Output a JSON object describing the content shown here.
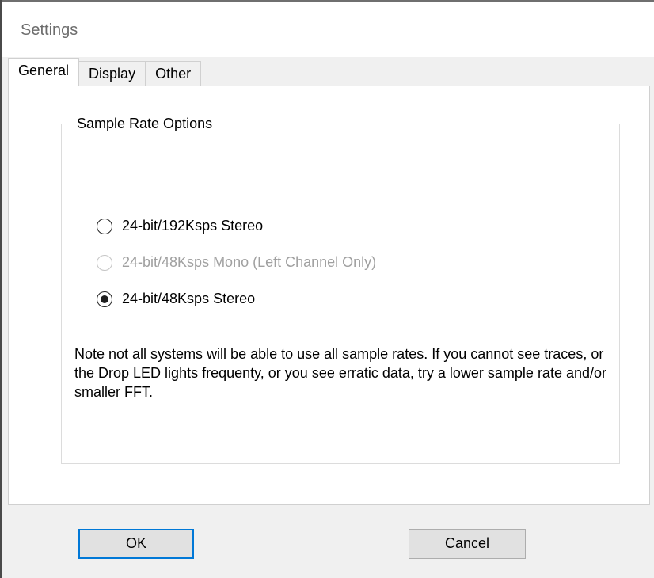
{
  "window": {
    "title": "Settings"
  },
  "tabs": [
    {
      "label": "General",
      "active": true
    },
    {
      "label": "Display",
      "active": false
    },
    {
      "label": "Other",
      "active": false
    }
  ],
  "sample_rate_group": {
    "legend": "Sample Rate Options",
    "options": [
      {
        "label": "24-bit/192Ksps Stereo",
        "selected": false,
        "enabled": true
      },
      {
        "label": "24-bit/48Ksps Mono (Left Channel Only)",
        "selected": false,
        "enabled": false
      },
      {
        "label": "24-bit/48Ksps Stereo",
        "selected": true,
        "enabled": true
      }
    ],
    "note": "Note not all systems will be able to use all sample rates. If you cannot see traces, or the Drop LED lights frequenty, or you see erratic data, try a lower sample rate and/or smaller FFT."
  },
  "buttons": {
    "ok_label": "OK",
    "cancel_label": "Cancel"
  },
  "colors": {
    "focus_accent": "#0078d7",
    "dialog_background": "#f0f0f0",
    "disabled_text": "#a0a0a0"
  }
}
